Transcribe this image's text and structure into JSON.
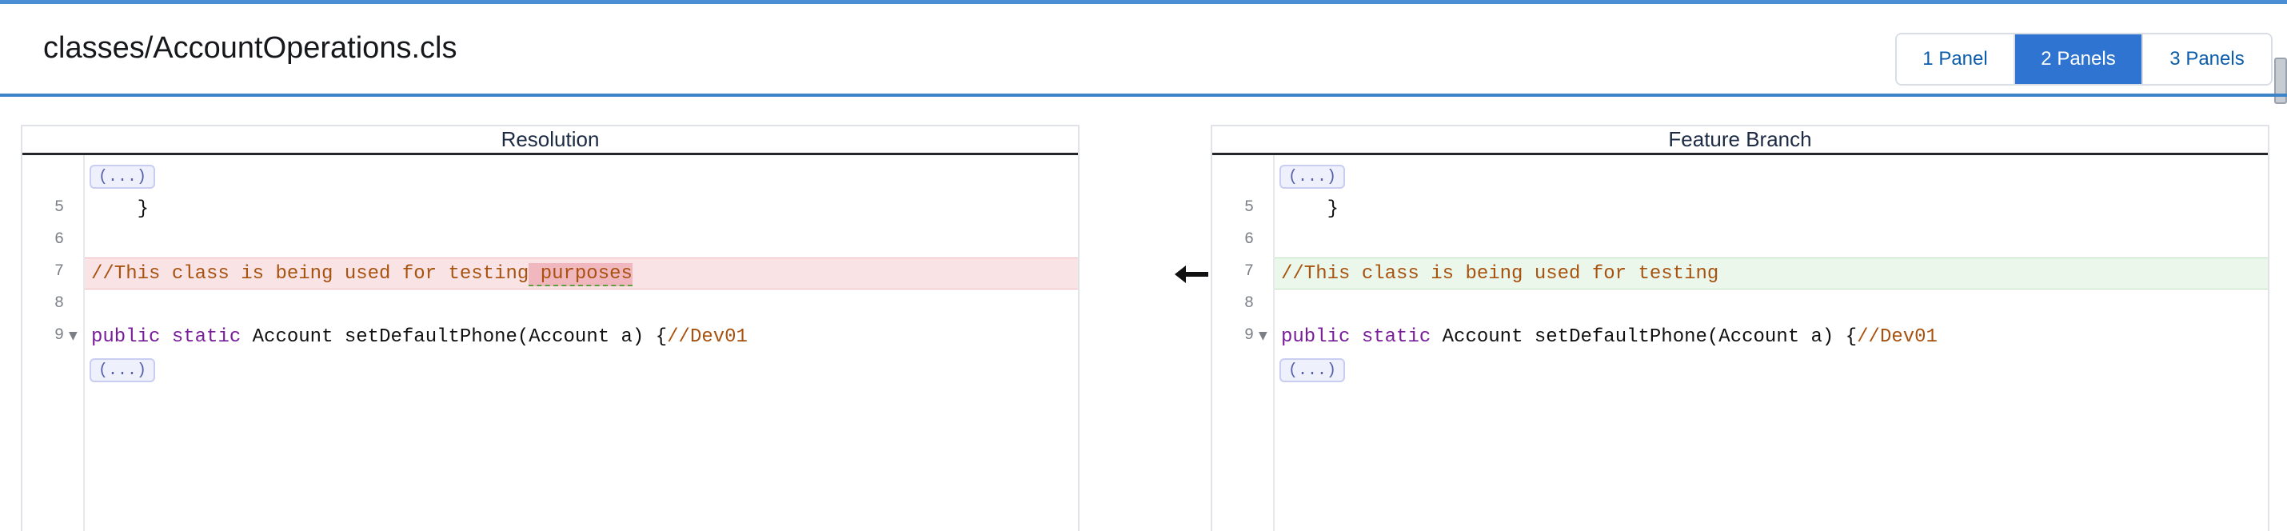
{
  "header": {
    "file_path": "classes/AccountOperations.cls",
    "panel_options": [
      "1 Panel",
      "2 Panels",
      "3 Panels"
    ],
    "selected_panel": "2 Panels"
  },
  "left_pane": {
    "title": "Resolution",
    "collapsed_label": "(...)",
    "lines": [
      {
        "num": "5",
        "text": "    }"
      },
      {
        "num": "6",
        "text": ""
      },
      {
        "num": "7",
        "comment_prefix": "//This class is being used for testing",
        "comment_highlight": " purposes"
      },
      {
        "num": "8",
        "text": ""
      },
      {
        "num": "9",
        "kw1": "public",
        "kw2": "static",
        "plain": " Account setDefaultPhone(Account a) {",
        "comment": "//Dev01"
      }
    ]
  },
  "right_pane": {
    "title": "Feature Branch",
    "collapsed_label": "(...)",
    "lines": [
      {
        "num": "5",
        "text": "    }"
      },
      {
        "num": "6",
        "text": ""
      },
      {
        "num": "7",
        "comment": "//This class is being used for testing"
      },
      {
        "num": "8",
        "text": ""
      },
      {
        "num": "9",
        "kw1": "public",
        "kw2": "static",
        "plain": " Account setDefaultPhone(Account a) {",
        "comment": "//Dev01"
      }
    ]
  },
  "merge_arrow": {
    "icon": "arrow-left-icon"
  },
  "colors": {
    "accent": "#2f74d0",
    "removed_bg": "#f9e3e5",
    "added_bg": "#eaf7ea",
    "keyword": "#7a1d9a",
    "comment": "#a8520f"
  }
}
